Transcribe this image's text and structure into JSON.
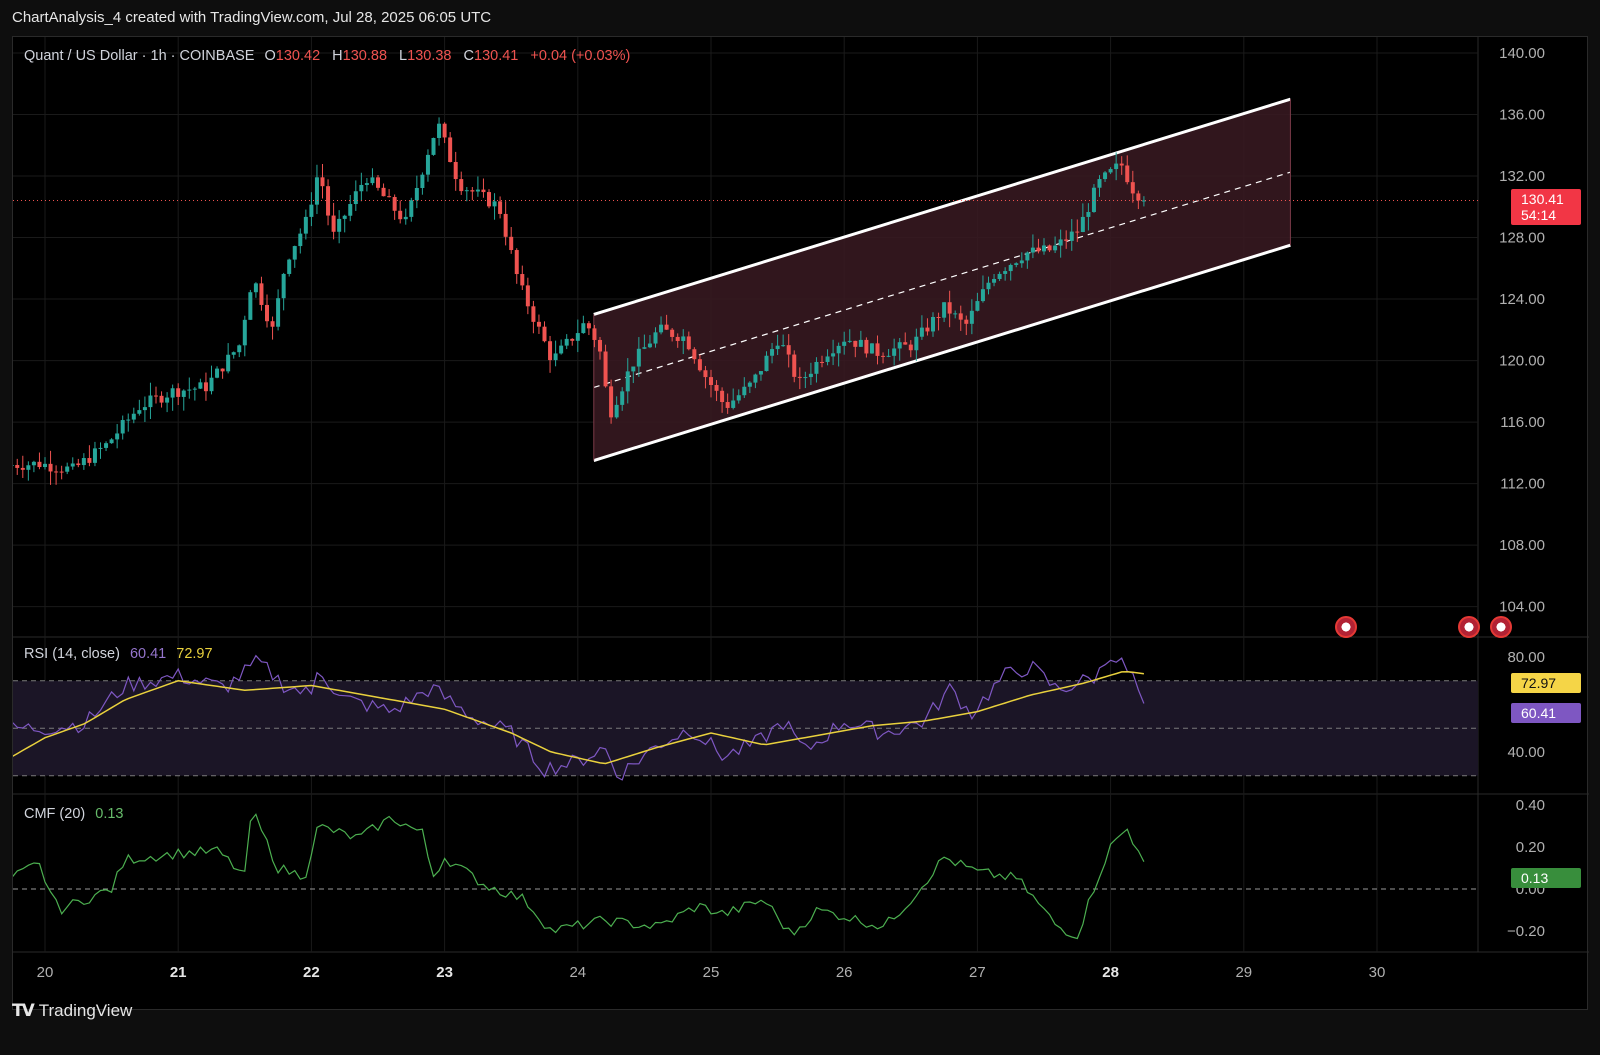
{
  "caption": "ChartAnalysis_4 created with TradingView.com, Jul 28, 2025 06:05 UTC",
  "legend": {
    "symbol": "Quant / US Dollar · 1h · COINBASE",
    "o_label": "O",
    "open": "130.42",
    "h_label": "H",
    "high": "130.88",
    "l_label": "L",
    "low": "130.38",
    "c_label": "C",
    "close": "130.41",
    "change": "+0.04 (+0.03%)"
  },
  "price_tag": {
    "price": "130.41",
    "countdown": "54:14"
  },
  "rsi_legend": {
    "label": "RSI (14, close)",
    "rsi": "60.41",
    "ma": "72.97"
  },
  "rsi_tags": {
    "ma": "72.97",
    "rsi": "60.41"
  },
  "cmf_legend": {
    "label": "CMF (20)",
    "value": "0.13"
  },
  "cmf_tag": "0.13",
  "branding": "TradingView",
  "colors": {
    "up": "#26a69a",
    "down": "#ef5350",
    "channel_fill": "#3a1a22",
    "rsi_line": "#7e57c2",
    "rsi_ma": "#e9d13d",
    "cmf_line": "#4caf50",
    "price_line": "#ef5350"
  },
  "icons": [
    "us-flag-icon",
    "us-flag-icon",
    "us-flag-icon",
    "tradingview-logo-icon"
  ],
  "chart_data": [
    {
      "type": "candlestick",
      "title": "Quant / US Dollar · 1h · COINBASE",
      "x_ticks": [
        "20",
        "21",
        "22",
        "23",
        "24",
        "25",
        "26",
        "27",
        "28",
        "29",
        "30"
      ],
      "y_ticks": [
        "140.00",
        "136.00",
        "132.00",
        "128.00",
        "124.00",
        "120.00",
        "116.00",
        "112.00",
        "108.00",
        "104.00"
      ],
      "ylim": [
        102.5,
        141.5
      ],
      "xlim_days": [
        19.75,
        30.75
      ],
      "last_price": 130.41,
      "series": [
        {
          "anchors_day_price": [
            [
              19.75,
              113.2
            ],
            [
              20.0,
              113.3
            ],
            [
              20.25,
              112.9
            ],
            [
              20.5,
              114.5
            ],
            [
              20.75,
              117.0
            ],
            [
              21.0,
              118.0
            ],
            [
              21.25,
              118.3
            ],
            [
              21.5,
              121.0
            ],
            [
              21.6,
              125.5
            ],
            [
              21.75,
              122.0
            ],
            [
              21.85,
              126.5
            ],
            [
              22.0,
              129.0
            ],
            [
              22.1,
              132.5
            ],
            [
              22.2,
              128.0
            ],
            [
              22.45,
              132.0
            ],
            [
              22.75,
              129.0
            ],
            [
              22.95,
              134.5
            ],
            [
              23.0,
              135.2
            ],
            [
              23.15,
              131.5
            ],
            [
              23.45,
              130.0
            ],
            [
              23.6,
              125.0
            ],
            [
              23.85,
              120.0
            ],
            [
              24.1,
              122.5
            ],
            [
              24.2,
              121.0
            ],
            [
              24.28,
              116.5
            ],
            [
              24.45,
              119.8
            ],
            [
              24.65,
              122.0
            ],
            [
              24.85,
              121.5
            ],
            [
              25.0,
              119.0
            ],
            [
              25.15,
              117.0
            ],
            [
              25.35,
              118.5
            ],
            [
              25.55,
              121.5
            ],
            [
              25.7,
              118.5
            ],
            [
              25.9,
              120.5
            ],
            [
              26.05,
              121.5
            ],
            [
              26.3,
              120.5
            ],
            [
              26.55,
              121.0
            ],
            [
              26.8,
              123.5
            ],
            [
              26.95,
              122.2
            ],
            [
              27.15,
              125.5
            ],
            [
              27.4,
              127.0
            ],
            [
              27.6,
              127.2
            ],
            [
              27.8,
              128.5
            ],
            [
              27.95,
              131.5
            ],
            [
              28.12,
              132.8
            ],
            [
              28.25,
              130.41
            ]
          ]
        }
      ],
      "channel": {
        "upper": [
          [
            24.12,
            123.0
          ],
          [
            29.35,
            137.0
          ]
        ],
        "lower": [
          [
            24.12,
            113.5
          ],
          [
            29.35,
            127.5
          ]
        ]
      }
    },
    {
      "type": "line",
      "title": "RSI (14, close)",
      "y_ticks": [
        "80.00",
        "40.00"
      ],
      "ylim": [
        27,
        84
      ],
      "bands": [
        70,
        50,
        30
      ],
      "series": [
        {
          "name": "RSI",
          "last": 60.41,
          "anchors_day_value": [
            [
              19.75,
              50
            ],
            [
              20.0,
              50
            ],
            [
              20.3,
              52
            ],
            [
              20.6,
              68
            ],
            [
              21.0,
              72
            ],
            [
              21.35,
              67
            ],
            [
              21.6,
              78
            ],
            [
              21.8,
              68
            ],
            [
              22.0,
              64
            ],
            [
              22.05,
              77
            ],
            [
              22.2,
              63
            ],
            [
              22.6,
              57
            ],
            [
              22.9,
              67
            ],
            [
              23.2,
              55
            ],
            [
              23.5,
              48
            ],
            [
              23.75,
              33
            ],
            [
              24.0,
              36
            ],
            [
              24.2,
              42
            ],
            [
              24.3,
              30
            ],
            [
              24.6,
              43
            ],
            [
              24.85,
              50
            ],
            [
              25.1,
              38
            ],
            [
              25.35,
              44
            ],
            [
              25.55,
              53
            ],
            [
              25.7,
              40
            ],
            [
              26.0,
              53
            ],
            [
              26.3,
              48
            ],
            [
              26.6,
              53
            ],
            [
              26.8,
              67
            ],
            [
              26.95,
              56
            ],
            [
              27.2,
              72
            ],
            [
              27.4,
              76
            ],
            [
              27.6,
              66
            ],
            [
              27.9,
              72
            ],
            [
              28.0,
              82
            ],
            [
              28.1,
              76
            ],
            [
              28.18,
              70
            ],
            [
              28.25,
              60.41
            ]
          ]
        },
        {
          "name": "RSI-based MA",
          "last": 72.97,
          "anchors_day_value": [
            [
              19.75,
              38
            ],
            [
              20.0,
              46
            ],
            [
              20.3,
              52
            ],
            [
              20.6,
              62
            ],
            [
              21.0,
              70
            ],
            [
              21.5,
              66
            ],
            [
              22.0,
              68
            ],
            [
              22.6,
              62
            ],
            [
              23.0,
              58
            ],
            [
              23.5,
              48
            ],
            [
              23.8,
              40
            ],
            [
              24.2,
              35
            ],
            [
              24.6,
              42
            ],
            [
              25.0,
              48
            ],
            [
              25.4,
              43
            ],
            [
              25.8,
              47
            ],
            [
              26.2,
              51
            ],
            [
              26.6,
              53
            ],
            [
              27.0,
              57
            ],
            [
              27.4,
              64
            ],
            [
              27.8,
              69
            ],
            [
              28.1,
              74
            ],
            [
              28.25,
              72.97
            ]
          ]
        }
      ]
    },
    {
      "type": "line",
      "title": "CMF (20)",
      "y_ticks": [
        "0.40",
        "0.20",
        "0.00",
        "−0.20"
      ],
      "ylim": [
        -0.27,
        0.44
      ],
      "series": [
        {
          "name": "CMF",
          "last": 0.13,
          "anchors_day_value": [
            [
              19.75,
              0.05
            ],
            [
              19.95,
              0.12
            ],
            [
              20.1,
              -0.1
            ],
            [
              20.5,
              0.0
            ],
            [
              20.6,
              0.14
            ],
            [
              21.0,
              0.17
            ],
            [
              21.3,
              0.18
            ],
            [
              21.5,
              0.06
            ],
            [
              21.55,
              0.38
            ],
            [
              21.75,
              0.1
            ],
            [
              21.95,
              0.06
            ],
            [
              22.05,
              0.3
            ],
            [
              22.35,
              0.24
            ],
            [
              22.6,
              0.34
            ],
            [
              22.85,
              0.26
            ],
            [
              22.9,
              0.05
            ],
            [
              23.0,
              0.15
            ],
            [
              23.3,
              0.02
            ],
            [
              23.6,
              -0.05
            ],
            [
              23.8,
              -0.2
            ],
            [
              24.2,
              -0.15
            ],
            [
              24.6,
              -0.18
            ],
            [
              24.9,
              -0.08
            ],
            [
              25.1,
              -0.12
            ],
            [
              25.4,
              -0.05
            ],
            [
              25.6,
              -0.22
            ],
            [
              25.8,
              -0.1
            ],
            [
              26.0,
              -0.13
            ],
            [
              26.3,
              -0.18
            ],
            [
              26.5,
              -0.05
            ],
            [
              26.75,
              0.15
            ],
            [
              27.0,
              0.08
            ],
            [
              27.3,
              0.05
            ],
            [
              27.6,
              -0.18
            ],
            [
              27.75,
              -0.22
            ],
            [
              27.9,
              0.05
            ],
            [
              28.0,
              0.2
            ],
            [
              28.12,
              0.29
            ],
            [
              28.25,
              0.13
            ]
          ]
        }
      ]
    }
  ]
}
